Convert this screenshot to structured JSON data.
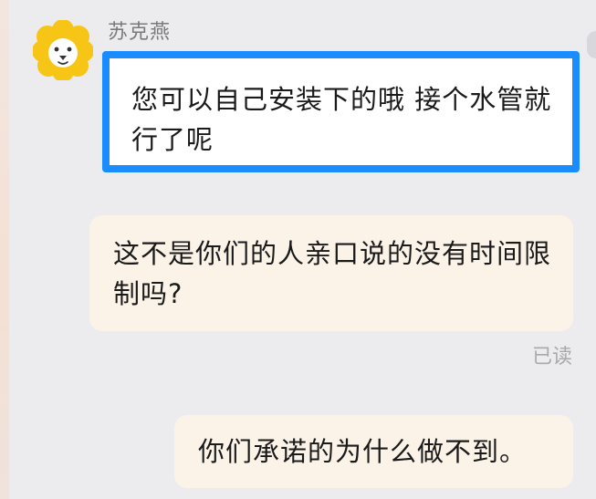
{
  "chat": {
    "incoming": {
      "sender_name": "苏克燕",
      "avatar_icon": "lion-mascot-icon",
      "text": "您可以自己安装下的哦 接个水管就行了呢",
      "highlight_color": "#1a8cff"
    },
    "outgoing": [
      {
        "text": "这不是你们的人亲口说的没有时间限制吗?"
      },
      {
        "text": "你们承诺的为什么做不到。"
      }
    ],
    "read_status": "已读"
  },
  "colors": {
    "background": "#ecebee",
    "incoming_bubble": "#ffffff",
    "outgoing_bubble": "#fbf3e8",
    "avatar_yellow": "#f7c515"
  }
}
